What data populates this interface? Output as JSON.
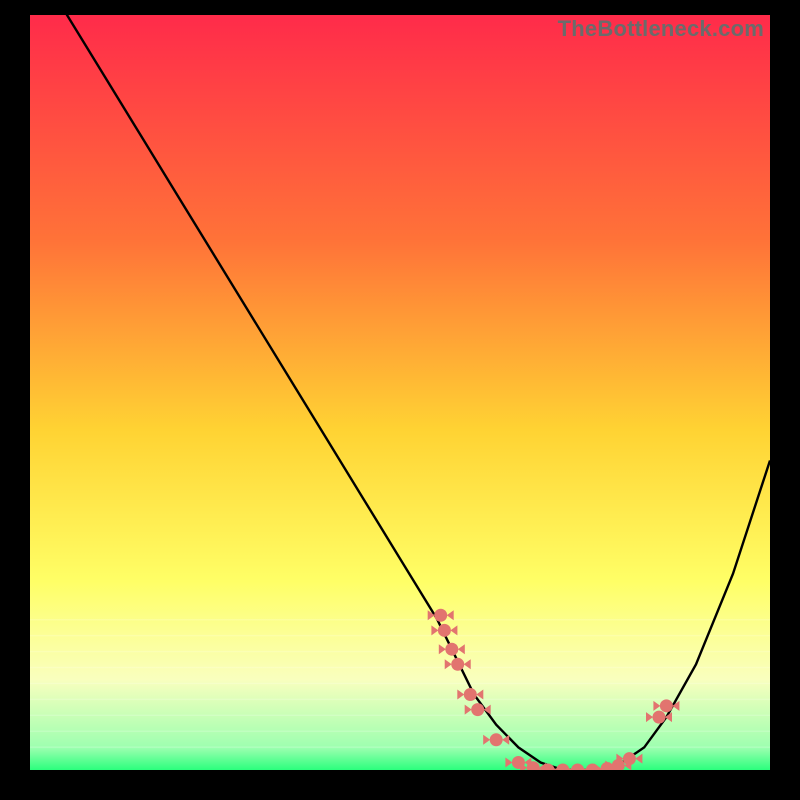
{
  "watermark": "TheBottleneck.com",
  "colors": {
    "bg": "#000000",
    "gradient_top": "#ff2b4a",
    "gradient_mid_upper": "#ff7338",
    "gradient_mid": "#ffd333",
    "gradient_mid_lower": "#ffff66",
    "gradient_lower": "#f9ffbe",
    "gradient_bottom": "#2bff7d",
    "curve": "#000000",
    "marker": "#e2746f"
  },
  "chart_data": {
    "type": "line",
    "title": "",
    "xlabel": "",
    "ylabel": "",
    "xlim": [
      0,
      100
    ],
    "ylim": [
      0,
      100
    ],
    "series": [
      {
        "name": "bottleneck-curve",
        "x": [
          0,
          5,
          10,
          15,
          20,
          25,
          30,
          35,
          40,
          45,
          50,
          55,
          58,
          60,
          63,
          66,
          69,
          72,
          75,
          78,
          80,
          83,
          86,
          90,
          95,
          100
        ],
        "y": [
          108,
          100,
          92,
          84,
          76,
          68,
          60,
          52,
          44,
          36,
          28,
          20,
          14,
          10,
          6,
          3,
          1,
          0,
          0,
          0,
          1,
          3,
          7,
          14,
          26,
          41
        ]
      }
    ],
    "markers": [
      {
        "x": 55.5,
        "y": 20.5
      },
      {
        "x": 56.0,
        "y": 18.5
      },
      {
        "x": 57.0,
        "y": 16.0
      },
      {
        "x": 57.8,
        "y": 14.0
      },
      {
        "x": 59.5,
        "y": 10.0
      },
      {
        "x": 60.5,
        "y": 8.0
      },
      {
        "x": 63.0,
        "y": 4.0
      },
      {
        "x": 66.0,
        "y": 1.0
      },
      {
        "x": 68.0,
        "y": 0.3
      },
      {
        "x": 70.0,
        "y": 0.0
      },
      {
        "x": 72.0,
        "y": 0.0
      },
      {
        "x": 74.0,
        "y": 0.0
      },
      {
        "x": 76.0,
        "y": 0.0
      },
      {
        "x": 78.0,
        "y": 0.2
      },
      {
        "x": 79.5,
        "y": 0.6
      },
      {
        "x": 81.0,
        "y": 1.5
      },
      {
        "x": 85.0,
        "y": 7.0
      },
      {
        "x": 86.0,
        "y": 8.5
      }
    ]
  }
}
